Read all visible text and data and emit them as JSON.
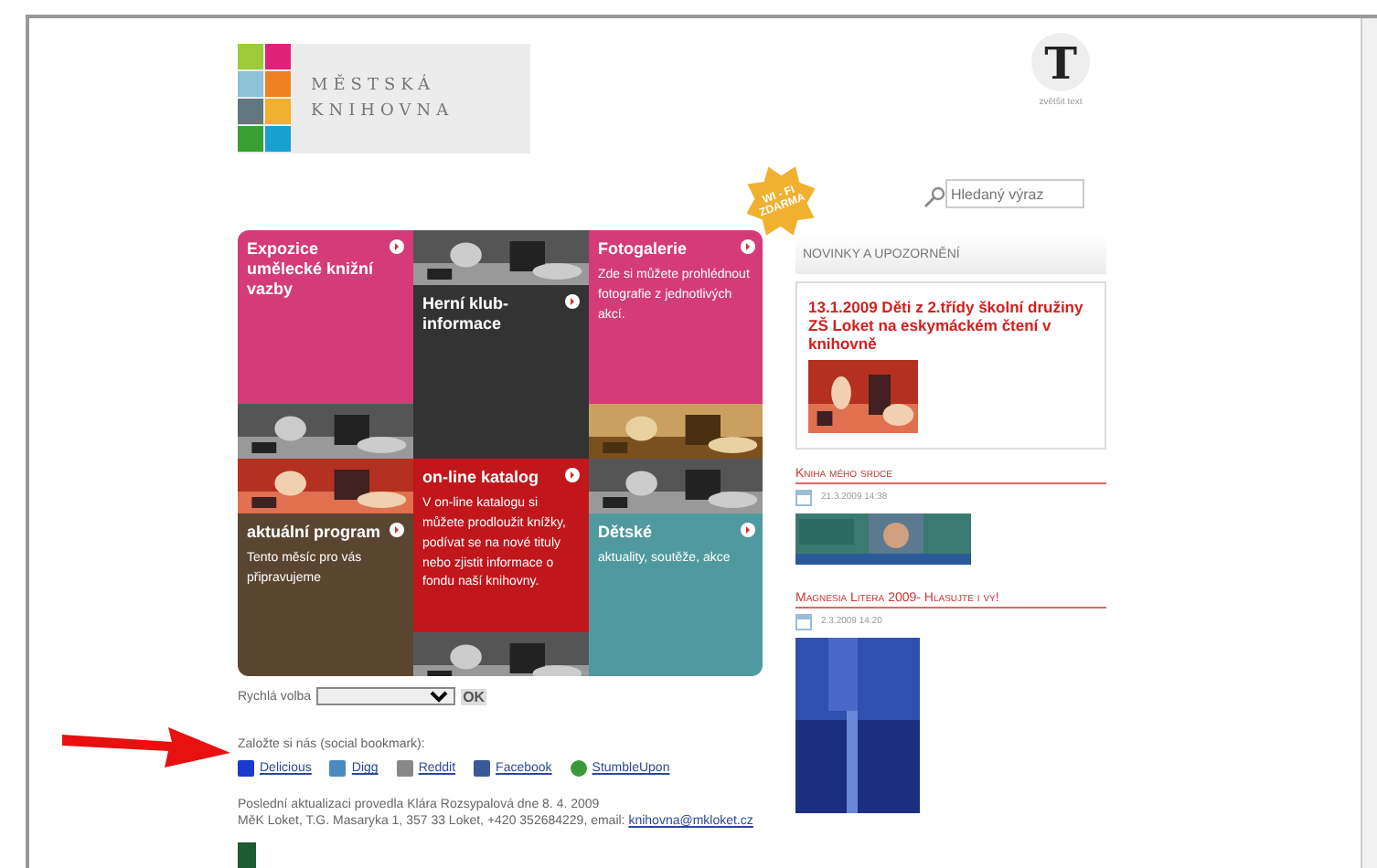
{
  "logo": {
    "line1": "MĚSTSKÁ",
    "line2": "KNIHOVNA"
  },
  "text_size": {
    "glyph": "T",
    "label": "zvětšit text"
  },
  "badge": {
    "line1": "WI - FI",
    "line2": "ZDARMA"
  },
  "search": {
    "placeholder": "Hledaný výraz"
  },
  "tiles": [
    [
      {
        "kind": "tile",
        "title": "Expozice umělecké knižní vazby",
        "color": "#d43b78"
      },
      {
        "kind": "picture"
      },
      {
        "kind": "picture"
      },
      {
        "kind": "tile",
        "title": "aktuální program",
        "text": "Tento měsíc pro vás připravujeme",
        "color": "#5a4630"
      }
    ],
    [
      {
        "kind": "picture"
      },
      {
        "kind": "tile",
        "title": "Herní klub-informace",
        "color": "#333333"
      },
      {
        "kind": "tile",
        "title": "on-line katalog",
        "text": "V on-line katalogu si můžete prodloužit knížky, podívat se na nové tituly nebo zjistit informace o fondu naší knihovny.",
        "color": "#c0161c"
      },
      {
        "kind": "picture"
      }
    ],
    [
      {
        "kind": "tile",
        "title": "Fotogalerie",
        "text": "Zde si můžete prohlédnout fotografie z jednotlivých akcí.",
        "color": "#d43b78"
      },
      {
        "kind": "picture"
      },
      {
        "kind": "picture"
      },
      {
        "kind": "tile",
        "title": "Dětské",
        "text": "aktuality, soutěže, akce",
        "color": "#4f9aa0"
      }
    ]
  ],
  "quick_choice": {
    "label": "Rychlá volba",
    "button": "OK"
  },
  "bookmark": {
    "label": "Založte si nás (social bookmark):",
    "links": [
      "Delicious",
      "Digg",
      "Reddit",
      "Facebook",
      "StumbleUpon"
    ]
  },
  "footer": {
    "updated": "Poslední aktualizaci provedla Klára Rozsypalová dne 8. 4. 2009",
    "address": "MěK Loket, T.G. Masaryka 1, 357 33 Loket, +420 352684229, email:",
    "email": "knihovna@mkloket.cz"
  },
  "news": {
    "heading": "NOVINKY A UPOZORNĚNÍ",
    "item": "13.1.2009 Děti z 2.třídy školní družiny ZŠ Loket na eskymáckém čtení v knihovně"
  },
  "articles": [
    {
      "title": "Kniha mého srdce",
      "date": "21.3.2009 14:38",
      "kind": "banner"
    },
    {
      "title": "Magnesia Litera 2009- Hlasujte i vy!",
      "date": "2.3.2009 14:20",
      "kind": "cover"
    }
  ]
}
